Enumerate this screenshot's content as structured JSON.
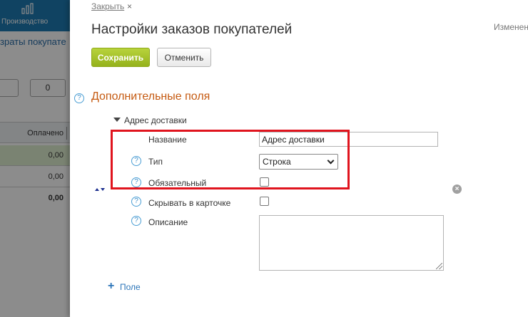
{
  "background": {
    "nav_label": "Производство",
    "subtitle": "зраты покупате",
    "counter_value": "0",
    "column_header": "Оплачено",
    "rows": [
      "0,00",
      "0,00"
    ],
    "total": "0,00"
  },
  "panel": {
    "close_label": "Закрыть",
    "close_icon": "×",
    "title": "Настройки заказов покупателей",
    "changed_label": "Изменен",
    "save_label": "Сохранить",
    "cancel_label": "Отменить",
    "section_title": "Дополнительные поля",
    "help_glyph": "?",
    "group_title": "Адрес доставки",
    "fields": {
      "name_label": "Название",
      "name_value": "Адрес доставки",
      "type_label": "Тип",
      "type_value": "Строка",
      "required_label": "Обязательный",
      "hide_label": "Скрывать в карточке",
      "description_label": "Описание"
    },
    "add_field_icon": "+",
    "add_field_label": "Поле"
  },
  "colors": {
    "accent_blue": "#2b74b8",
    "section_title": "#c55a11",
    "save_green": "#a2c12a",
    "highlight_red": "#e0141e"
  }
}
